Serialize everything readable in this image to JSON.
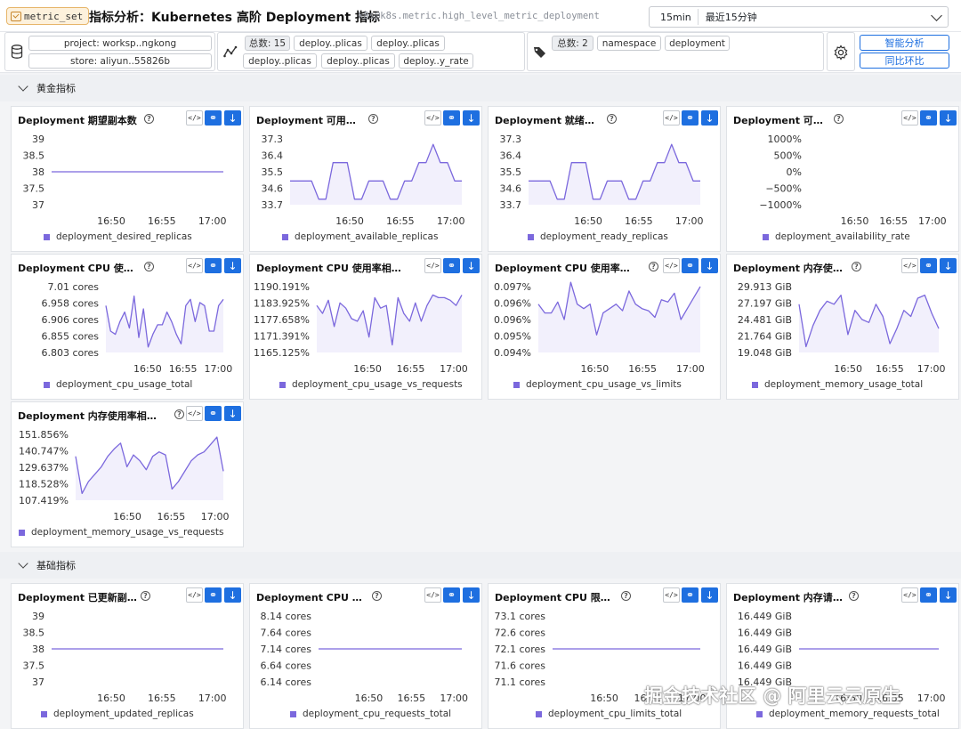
{
  "header": {
    "tag": "metric_set",
    "title": "指标分析：Kubernetes 高阶 Deployment 指标",
    "subtitle": "k8s@k8s.metric.high_level_metric_deployment",
    "time_chip": "15min",
    "time_label": "最近15分钟"
  },
  "filters": {
    "project": "project: worksp..ngkong",
    "store": "store: aliyun..55826b",
    "metrics_count": "总数: 15",
    "metric_chips": [
      "deploy..plicas",
      "deploy..plicas",
      "deploy..plicas",
      "deploy..plicas",
      "deploy..y_rate"
    ],
    "labels_count": "总数: 2",
    "label_chips": [
      "namespace",
      "deployment"
    ],
    "btn_smart": "智能分析",
    "btn_compare": "同比环比"
  },
  "sections": {
    "golden": "黄金指标",
    "basic": "基础指标"
  },
  "watermark": "掘金技术社区 @ 阿里云云原生",
  "accent_color": "#1e6fe0",
  "series_color": "#7b68dd",
  "panels": [
    {
      "title": "Deployment 期望副本数",
      "legend": "deployment_desired_replicas"
    },
    {
      "title": "Deployment 可用副本数",
      "legend": "deployment_available_replicas"
    },
    {
      "title": "Deployment 就绪副本数",
      "legend": "deployment_ready_replicas"
    },
    {
      "title": "Deployment 可用性",
      "legend": "deployment_availability_rate"
    },
    {
      "title": "Deployment CPU 使用总量",
      "legend": "deployment_cpu_usage_total"
    },
    {
      "title": "Deployment CPU 使用率相对...",
      "legend": "deployment_cpu_usage_vs_requests"
    },
    {
      "title": "Deployment CPU 使用率相对...",
      "legend": "deployment_cpu_usage_vs_limits"
    },
    {
      "title": "Deployment 内存使用总量",
      "legend": "deployment_memory_usage_total"
    },
    {
      "title": "Deployment 内存使用率相对于...",
      "legend": "deployment_memory_usage_vs_requests"
    },
    {
      "title": "Deployment 已更新副本数",
      "legend": "deployment_updated_replicas"
    },
    {
      "title": "Deployment CPU 请求总量",
      "legend": "deployment_cpu_requests_total"
    },
    {
      "title": "Deployment CPU 限制总量",
      "legend": "deployment_cpu_limits_total"
    },
    {
      "title": "Deployment 内存请求总量",
      "legend": "deployment_memory_requests_total"
    }
  ],
  "chart_data": [
    {
      "type": "line",
      "series": [
        {
          "name": "deployment_desired_replicas",
          "values": [
            38,
            38
          ]
        }
      ],
      "x": [
        "16:46",
        "17:01"
      ],
      "xticks": [
        "16:50",
        "16:55",
        "17:00"
      ],
      "yticks": [
        "39",
        "38.5",
        "38",
        "37.5",
        "37"
      ],
      "ylim": [
        37,
        39
      ]
    },
    {
      "type": "area",
      "series": [
        {
          "name": "deployment_available_replicas",
          "values": [
            35.0,
            35.0,
            35.0,
            35.0,
            34.0,
            34.0,
            36.0,
            36.0,
            36.0,
            34.0,
            34.0,
            35.0,
            35.0,
            35.0,
            34.0,
            34.0,
            35.0,
            35.0,
            36.0,
            36.0,
            37.0,
            36.0,
            36.0,
            35.0,
            35.0
          ]
        }
      ],
      "xticks": [
        "16:50",
        "16:55",
        "17:00"
      ],
      "yticks": [
        "37.3",
        "36.4",
        "35.5",
        "34.6",
        "33.7"
      ],
      "ylim": [
        33.7,
        37.3
      ]
    },
    {
      "type": "area",
      "series": [
        {
          "name": "deployment_ready_replicas",
          "values": [
            35.0,
            35.0,
            35.0,
            35.0,
            34.0,
            34.0,
            36.0,
            36.0,
            36.0,
            34.0,
            34.0,
            35.0,
            35.0,
            35.0,
            34.0,
            34.0,
            35.0,
            35.0,
            36.0,
            36.0,
            37.0,
            36.0,
            36.0,
            35.0,
            35.0
          ]
        }
      ],
      "xticks": [
        "16:50",
        "16:55",
        "17:00"
      ],
      "yticks": [
        "37.3",
        "36.4",
        "35.5",
        "34.6",
        "33.7"
      ],
      "ylim": [
        33.7,
        37.3
      ]
    },
    {
      "type": "line",
      "series": [
        {
          "name": "deployment_availability_rate",
          "values": []
        }
      ],
      "xticks": [
        "16:50",
        "16:55",
        "17:00"
      ],
      "yticks": [
        "1000%",
        "500%",
        "0%",
        "−500%",
        "−1000%"
      ],
      "ylim": [
        -1000,
        1000
      ]
    },
    {
      "type": "area",
      "series": [
        {
          "name": "deployment_cpu_usage_total",
          "values": [
            6.95,
            6.87,
            6.86,
            6.9,
            6.93,
            6.88,
            6.98,
            6.85,
            6.94,
            6.82,
            6.86,
            6.89,
            6.89,
            6.93,
            6.9,
            6.86,
            6.83,
            6.95,
            6.97,
            6.9,
            6.96,
            6.95,
            6.87,
            6.87,
            6.95,
            6.97
          ]
        }
      ],
      "xticks": [
        "16:50",
        "16:55",
        "17:00"
      ],
      "yticks": [
        "7.01 cores",
        "6.958 cores",
        "6.906 cores",
        "6.855 cores",
        "6.803 cores"
      ],
      "ylim": [
        6.803,
        7.01
      ]
    },
    {
      "type": "area",
      "series": [
        {
          "name": "deployment_cpu_usage_vs_requests",
          "values": [
            1183.0,
            1180.0,
            1185.0,
            1175.0,
            1184.0,
            1182.0,
            1178.0,
            1177.0,
            1181.0,
            1171.0,
            1186.0,
            1182.0,
            1183.0,
            1168.0,
            1186.0,
            1180.0,
            1177.0,
            1184.0,
            1177.0,
            1183.0,
            1187.0,
            1186.0,
            1186.0,
            1185.0,
            1183.0,
            1187.0
          ]
        }
      ],
      "xticks": [
        "16:50",
        "16:55",
        "17:00"
      ],
      "yticks": [
        "1190.191%",
        "1183.925%",
        "1177.658%",
        "1171.391%",
        "1165.125%"
      ],
      "ylim": [
        1165.125,
        1190.191
      ]
    },
    {
      "type": "area",
      "series": [
        {
          "name": "deployment_cpu_usage_vs_limits",
          "values": [
            0.0962,
            0.0958,
            0.0958,
            0.0963,
            0.0955,
            0.0972,
            0.0962,
            0.096,
            0.0962,
            0.0948,
            0.0958,
            0.096,
            0.0962,
            0.0959,
            0.0968,
            0.0962,
            0.096,
            0.0959,
            0.0956,
            0.0964,
            0.0963,
            0.0967,
            0.0955,
            0.096,
            0.0965,
            0.097
          ]
        }
      ],
      "xticks": [
        "16:50",
        "16:55",
        "17:00"
      ],
      "yticks": [
        "0.097%",
        "0.096%",
        "0.096%",
        "0.095%",
        "0.094%"
      ],
      "ylim": [
        0.094,
        0.097
      ]
    },
    {
      "type": "area",
      "series": [
        {
          "name": "deployment_memory_usage_total",
          "values": [
            27.0,
            20.0,
            23.5,
            26.0,
            27.5,
            27.0,
            28.5,
            22.0,
            26.0,
            24.5,
            24.0,
            27.0,
            25.0,
            20.5,
            23.0,
            26.0,
            25.0,
            28.0,
            28.5,
            25.5,
            23.0
          ]
        }
      ],
      "xticks": [
        "16:50",
        "16:55",
        "17:00"
      ],
      "yticks": [
        "29.913 GiB",
        "27.197 GiB",
        "24.481 GiB",
        "21.764 GiB",
        "19.048 GiB"
      ],
      "ylim": [
        19.048,
        29.913
      ]
    },
    {
      "type": "area",
      "series": [
        {
          "name": "deployment_memory_usage_vs_requests",
          "values": [
            137.0,
            112.0,
            120.0,
            125.0,
            130.0,
            137.0,
            142.0,
            146.0,
            130.0,
            138.0,
            134.0,
            128.0,
            137.0,
            140.0,
            138.0,
            115.0,
            120.0,
            127.0,
            134.0,
            138.0,
            140.0,
            145.0,
            150.0,
            127.0
          ]
        }
      ],
      "xticks": [
        "16:50",
        "16:55",
        "17:00"
      ],
      "yticks": [
        "151.856%",
        "140.747%",
        "129.637%",
        "118.528%",
        "107.419%"
      ],
      "ylim": [
        107.419,
        151.856
      ]
    },
    {
      "type": "line",
      "series": [
        {
          "name": "deployment_updated_replicas",
          "values": [
            38,
            38
          ]
        }
      ],
      "x": [
        "16:46",
        "17:01"
      ],
      "xticks": [
        "16:50",
        "16:55",
        "17:00"
      ],
      "yticks": [
        "39",
        "38.5",
        "38",
        "37.5",
        "37"
      ],
      "ylim": [
        37,
        39
      ]
    },
    {
      "type": "line",
      "series": [
        {
          "name": "deployment_cpu_requests_total",
          "values": [
            7.14,
            7.14
          ]
        }
      ],
      "x": [
        "16:46",
        "17:01"
      ],
      "xticks": [
        "16:50",
        "16:55",
        "17:00"
      ],
      "yticks": [
        "8.14 cores",
        "7.64 cores",
        "7.14 cores",
        "6.64 cores",
        "6.14 cores"
      ],
      "ylim": [
        6.14,
        8.14
      ]
    },
    {
      "type": "line",
      "series": [
        {
          "name": "deployment_cpu_limits_total",
          "values": [
            72.1,
            72.1
          ]
        }
      ],
      "x": [
        "16:46",
        "17:01"
      ],
      "xticks": [
        "16:50",
        "16:55",
        "17:00"
      ],
      "yticks": [
        "73.1 cores",
        "72.6 cores",
        "72.1 cores",
        "71.6 cores",
        "71.1 cores"
      ],
      "ylim": [
        71.1,
        73.1
      ]
    },
    {
      "type": "line",
      "series": [
        {
          "name": "deployment_memory_requests_total",
          "values": [
            16.449,
            16.449
          ]
        }
      ],
      "x": [
        "16:46",
        "17:01"
      ],
      "xticks": [
        "16:50",
        "16:55",
        "17:00"
      ],
      "yticks": [
        "16.449 GiB",
        "16.449 GiB",
        "16.449 GiB",
        "16.449 GiB",
        "16.449 GiB"
      ],
      "ylim": [
        16.448,
        16.45
      ]
    }
  ]
}
